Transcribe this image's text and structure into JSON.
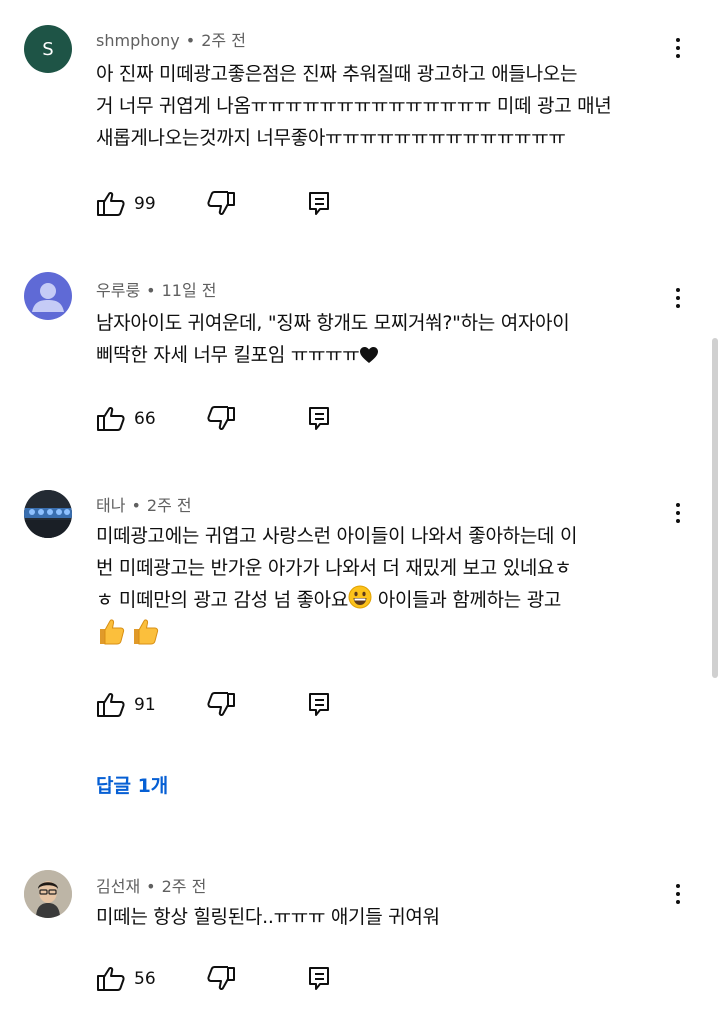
{
  "comments": [
    {
      "author": "shmphony",
      "avatar_letter": "S",
      "time": "2주 전",
      "text": "아 진짜 미떼광고좋은점은 진짜 추워질때 광고하고 애들나오는\n거 너무 귀엽게 나옴ㅠㅠㅠㅠㅠㅠㅠㅠㅠㅠㅠㅠㅠㅠ 미떼 광고 매년\n새롭게나오는것까지 너무좋아ㅠㅠㅠㅠㅠㅠㅠㅠㅠㅠㅠㅠㅠㅠ",
      "likes": "99"
    },
    {
      "author": "우루룽",
      "time": "11일 전",
      "text": "남자아이도 귀여운데, \"징짜 항개도 모찌거쒀?\"하는 여자아이\n삐딱한 자세 너무 킬포임 ㅠㅠㅠㅠ",
      "likes": "66"
    },
    {
      "author": "태나",
      "time": "2주 전",
      "text": "미떼광고에는 귀엽고 사랑스런 아이들이 나와서 좋아하는데 이\n번 미떼광고는 반가운 아가가 나와서 더 재밌게 보고 있네요ㅎ\nㅎ 미떼만의 광고 감성 넘 좋아요",
      "text_tail": " 아이들과 함께하는 광고",
      "likes": "91",
      "replies": "답글 1개"
    },
    {
      "author": "김선재",
      "time": "2주 전",
      "text": "미떼는 항상 힐링된다..ㅠㅠㅠ 애기들 귀여워",
      "likes": "56"
    }
  ],
  "icons": {
    "like": "thumbs-up-icon",
    "dislike": "thumbs-down-icon",
    "reply": "reply-icon",
    "more": "more-vertical-icon",
    "heart": "heart-icon",
    "grin": "grinning-face-icon",
    "thumbs_emoji": "thumbs-up-emoji-icon"
  },
  "colors": {
    "avatar_s_bg": "#1e5446",
    "link_blue": "#065fd4",
    "meta_gray": "#606060",
    "text": "#0f0f0f"
  }
}
